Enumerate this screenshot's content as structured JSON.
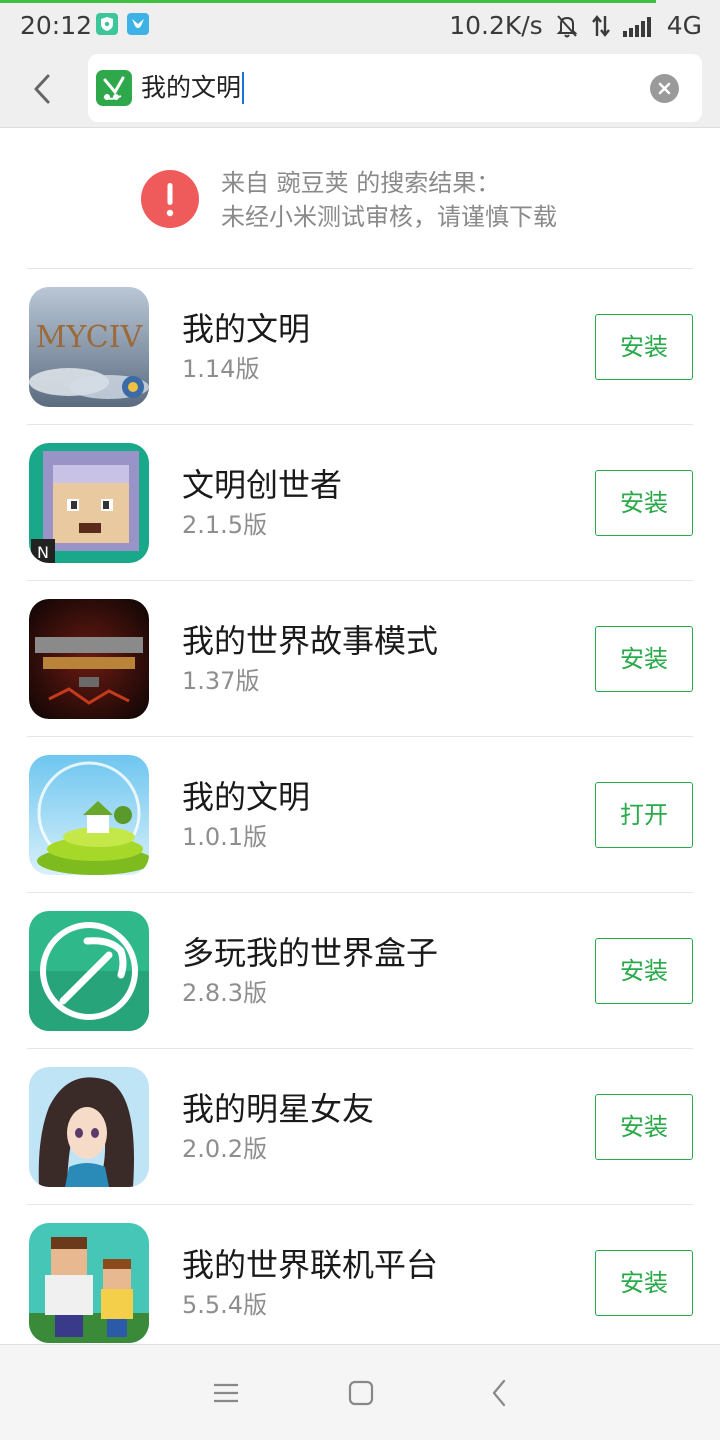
{
  "status_bar": {
    "time": "20:12",
    "speed": "10.2K/s",
    "network": "4G",
    "icons": [
      "shield-app-icon",
      "bird-app-icon",
      "bell-muted-icon",
      "data-arrows-icon",
      "signal-icon"
    ]
  },
  "search": {
    "query": "我的文明",
    "app_logo": "wandoujia-logo-icon"
  },
  "notice": {
    "line1": "来自 豌豆荚 的搜索结果：",
    "line2": "未经小米测试审核，请谨慎下载",
    "icon": "warning-icon"
  },
  "apps": [
    {
      "name": "我的文明",
      "version": "1.14版",
      "action": "安装",
      "icon": "mycivilization-app-icon"
    },
    {
      "name": "文明创世者",
      "version": "2.1.5版",
      "action": "安装",
      "icon": "pixel-character-app-icon"
    },
    {
      "name": "我的世界故事模式",
      "version": "1.37版",
      "action": "安装",
      "icon": "minecraft-story-mode-app-icon"
    },
    {
      "name": "我的文明",
      "version": "1.0.1版",
      "action": "打开",
      "icon": "island-house-app-icon"
    },
    {
      "name": "多玩我的世界盒子",
      "version": "2.8.3版",
      "action": "安装",
      "icon": "pickaxe-app-icon"
    },
    {
      "name": "我的明星女友",
      "version": "2.0.2版",
      "action": "安装",
      "icon": "anime-girl-app-icon"
    },
    {
      "name": "我的世界联机平台",
      "version": "5.5.4版",
      "action": "安装",
      "icon": "blocky-characters-app-icon"
    }
  ],
  "colors": {
    "accent_green": "#2aaa4a",
    "warning_red": "#ef5b5b",
    "header_bg": "#efefef"
  },
  "nav": {
    "icons": [
      "menu-icon",
      "home-icon",
      "back-icon"
    ]
  }
}
